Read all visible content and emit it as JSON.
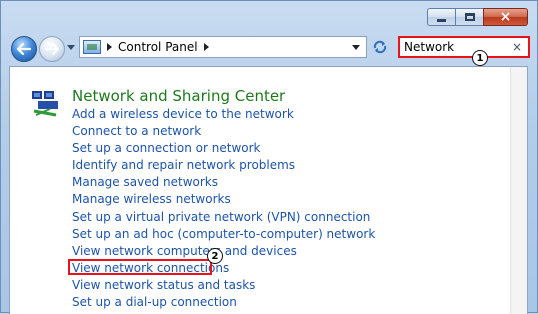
{
  "window": {
    "caption_buttons": {
      "minimize": "minimize",
      "maximize": "maximize",
      "close": "×"
    }
  },
  "toolbar": {
    "breadcrumb": [
      "Control Panel"
    ],
    "search": {
      "value": "Network",
      "clear": "×"
    }
  },
  "markers": {
    "search": "1",
    "link": "2"
  },
  "main": {
    "section_title": "Network and Sharing Center",
    "links": [
      "Add a wireless device to the network",
      "Connect to a network",
      "Set up a connection or network",
      "Identify and repair network problems",
      "Manage saved networks",
      "Manage wireless networks",
      "Set up a virtual private network (VPN) connection",
      "Set up an ad hoc (computer-to-computer) network",
      "View network computers and devices",
      "View network connections",
      "View network status and tasks",
      "Set up a dial-up connection"
    ],
    "highlighted_link_index": 9
  },
  "colors": {
    "title_green": "#1e7a1e",
    "link_blue": "#1d54a8",
    "highlight_red": "#e8141a"
  },
  "icons": {
    "back": "back-arrow-icon",
    "forward": "forward-arrow-icon",
    "refresh": "refresh-icon",
    "clear": "clear-icon",
    "control_panel": "control-panel-icon",
    "network": "network-icon"
  }
}
